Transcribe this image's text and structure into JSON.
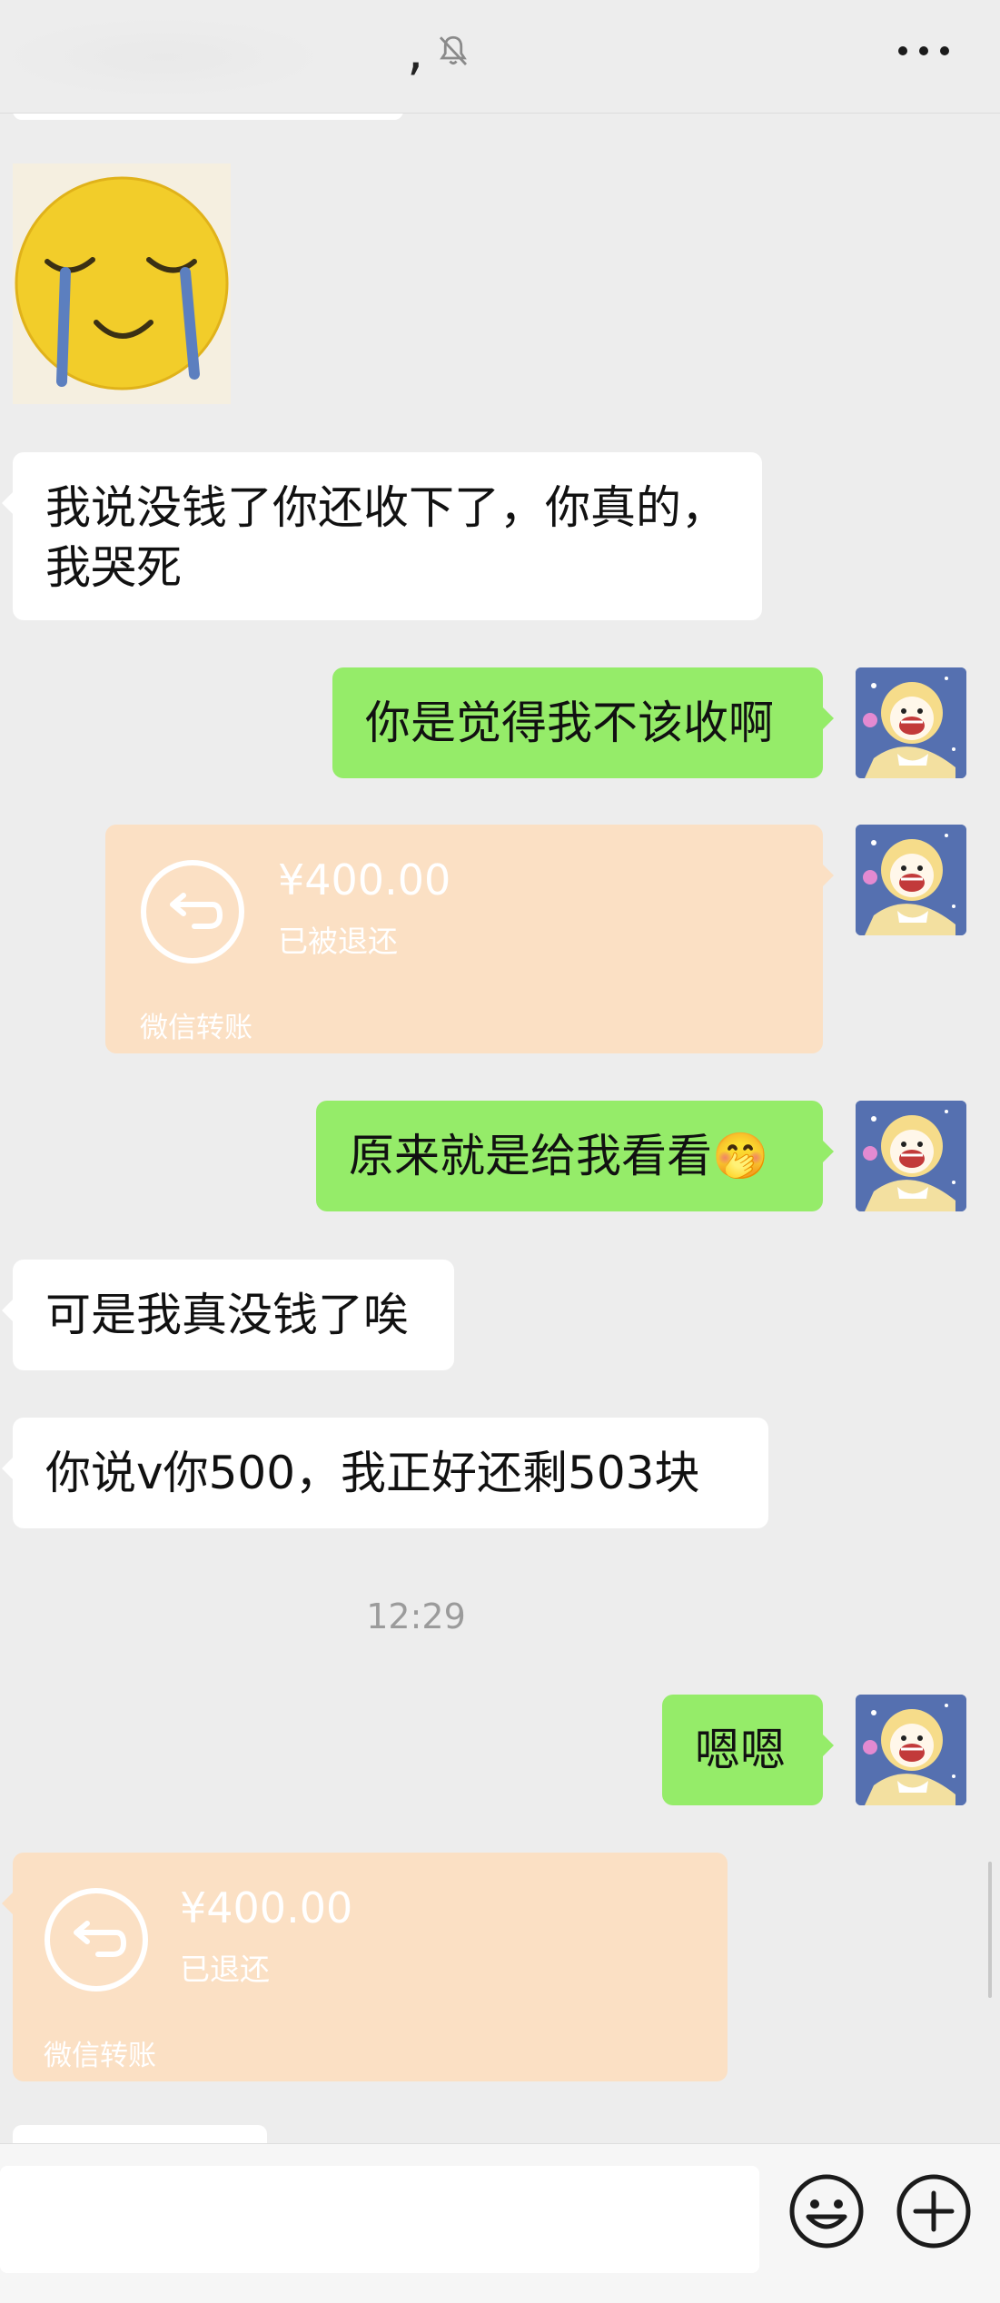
{
  "header": {
    "title_fragment": ",",
    "mute_icon": "bell-slash-icon",
    "more_icon": "more-icon"
  },
  "messages": {
    "m1": "我说没钱了你还收下了，你真的，",
    "m1_line2": "我哭死",
    "m2": "你是觉得我不该收啊",
    "m3": "原来就是给我看看",
    "m3_emoji": "🤭",
    "m4": "可是我真没钱了唉",
    "m5": "你说v你500，我正好还剩503块",
    "m6": "嗯嗯"
  },
  "transfer1": {
    "amount": "¥400.00",
    "status": "已被退还",
    "kind": "微信转账"
  },
  "transfer2": {
    "amount": "¥400.00",
    "status": "已退还",
    "kind": "微信转账"
  },
  "timestamp": "12:29",
  "input": {
    "value": "",
    "emoji_icon": "smiley-icon",
    "plus_icon": "plus-circle-icon"
  },
  "colors": {
    "background": "#ededed",
    "sent_bubble": "#95ec69",
    "received_bubble": "#ffffff",
    "transfer_card": "#fbe0c4"
  }
}
